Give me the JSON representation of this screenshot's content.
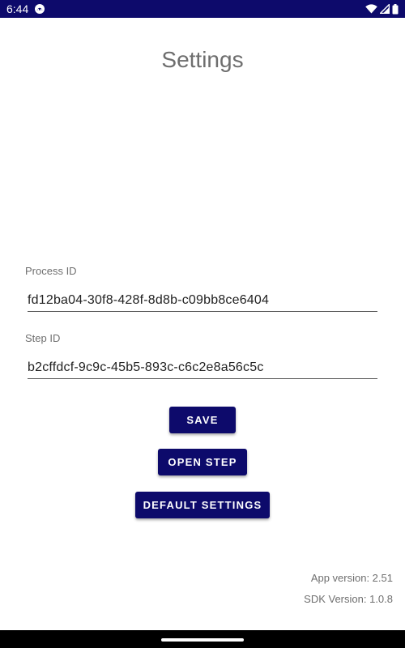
{
  "status_bar": {
    "time": "6:44",
    "icons": [
      "app-notification-icon",
      "wifi-icon",
      "cell-signal-icon",
      "battery-icon"
    ],
    "background_color": "#0d0a6b"
  },
  "header": {
    "title": "Settings"
  },
  "form": {
    "process_id": {
      "label": "Process ID",
      "value": "fd12ba04-30f8-428f-8d8b-c09bb8ce6404"
    },
    "step_id": {
      "label": "Step ID",
      "value": "b2cffdcf-9c9c-45b5-893c-c6c2e8a56c5c"
    }
  },
  "actions": {
    "save_label": "SAVE",
    "open_step_label": "OPEN STEP",
    "default_settings_label": "DEFAULT SETTINGS",
    "button_color": "#0d0a6b"
  },
  "footer": {
    "app_version": "App version: 2.51",
    "sdk_version": "SDK Version: 1.0.8"
  }
}
